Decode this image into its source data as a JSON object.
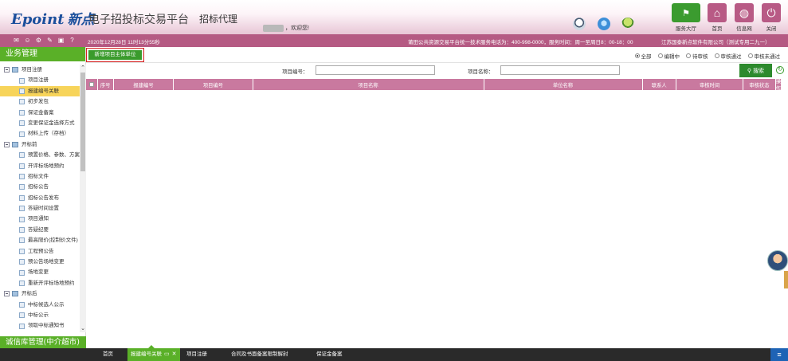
{
  "header": {
    "brand": "Epoint",
    "brand_cn": "新点",
    "platform_title": "电子招投标交易平台",
    "agent_title": "招标代理",
    "welcome": "，欢迎您!",
    "buttons": {
      "service_hall": "服务大厅",
      "home": "首页",
      "info_net": "信息网",
      "close": "关闭"
    }
  },
  "infobar": {
    "datetime": "2020年12月28日 11时13分55秒",
    "hotline": "莆田公共资源交易平台统一技术服务电话为：400-998-0000，服务时间：周一至周日8：00-18：00",
    "copyright": "江苏国泰新点软件有限公司（测试专用二九一）"
  },
  "sidebar": {
    "title": "业务管理",
    "footer": "诚信库管理(中介超市)",
    "items": [
      {
        "label": "项目注册",
        "type": "group"
      },
      {
        "label": "项目注册",
        "type": "sub"
      },
      {
        "label": "报建编号关联",
        "type": "sub",
        "active": true
      },
      {
        "label": "初步发包",
        "type": "sub"
      },
      {
        "label": "保证金备案",
        "type": "sub"
      },
      {
        "label": "变更保证金选择方式",
        "type": "sub"
      },
      {
        "label": "材料上传（存档）",
        "type": "sub"
      },
      {
        "label": "开标前",
        "type": "group"
      },
      {
        "label": "预置价格、参数、方案",
        "type": "sub"
      },
      {
        "label": "开评标场地预约",
        "type": "sub"
      },
      {
        "label": "招标文件",
        "type": "sub"
      },
      {
        "label": "招标公告",
        "type": "sub"
      },
      {
        "label": "招标公告发布",
        "type": "sub"
      },
      {
        "label": "答疑时间设置",
        "type": "sub"
      },
      {
        "label": "项目通知",
        "type": "sub"
      },
      {
        "label": "答疑纪要",
        "type": "sub"
      },
      {
        "label": "最高限价(控制价文件)",
        "type": "sub"
      },
      {
        "label": "工程预公告",
        "type": "sub"
      },
      {
        "label": "预公告场地变更",
        "type": "sub"
      },
      {
        "label": "场地变更",
        "type": "sub"
      },
      {
        "label": "重新开评标场地预约",
        "type": "sub"
      },
      {
        "label": "开标后",
        "type": "group"
      },
      {
        "label": "中标候选人公示",
        "type": "sub"
      },
      {
        "label": "中标公示",
        "type": "sub"
      },
      {
        "label": "领取中标通知书",
        "type": "sub"
      }
    ]
  },
  "toolbar": {
    "add_label": "新增项目主体单位",
    "filters": [
      {
        "label": "全部",
        "checked": true
      },
      {
        "label": "编辑中",
        "checked": false
      },
      {
        "label": "待审核",
        "checked": false
      },
      {
        "label": "审核通过",
        "checked": false
      },
      {
        "label": "审核未通过",
        "checked": false
      }
    ]
  },
  "search": {
    "code_label": "项目编号：",
    "code_value": "",
    "name_label": "项目名称：",
    "name_value": "",
    "button_label": "搜索"
  },
  "grid": {
    "columns": [
      "序号",
      "报建编号",
      "项目编号",
      "项目名称",
      "单位名称",
      "联系人",
      "审核时间",
      "审核状态",
      "操作"
    ],
    "rows": []
  },
  "taskbar": {
    "tabs": [
      {
        "label": "首页",
        "active": false
      },
      {
        "label": "报建编号关联",
        "active": true
      },
      {
        "label": "项目注册",
        "active": false
      },
      {
        "label": "合同及书面备案限制解封",
        "active": false
      },
      {
        "label": "保证金备案",
        "active": false
      }
    ]
  },
  "colors": {
    "brand_pink": "#b55a83",
    "grid_header": "#c9799f",
    "green": "#5ab028",
    "active_item": "#f7d45a"
  }
}
